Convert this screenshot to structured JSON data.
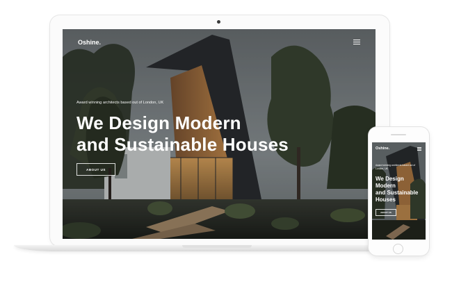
{
  "brand": {
    "logo": "Oshine."
  },
  "hero": {
    "tagline": "Award winning architects based out of London, UK",
    "headline_line1": "We Design Modern",
    "headline_line2": "and Sustainable Houses",
    "cta_label": "ABOUT US"
  },
  "mobile": {
    "tagline": "Award winning architects based out of London, UK",
    "headline_line1": "We Design",
    "headline_line2": "Modern",
    "headline_line3": "and Sustainable",
    "headline_line4": "Houses",
    "cta_label": "ABOUT US"
  },
  "icons": [
    "hamburger-menu-icon"
  ],
  "colors": {
    "text": "#ffffff",
    "device": "#fbfbfb"
  }
}
